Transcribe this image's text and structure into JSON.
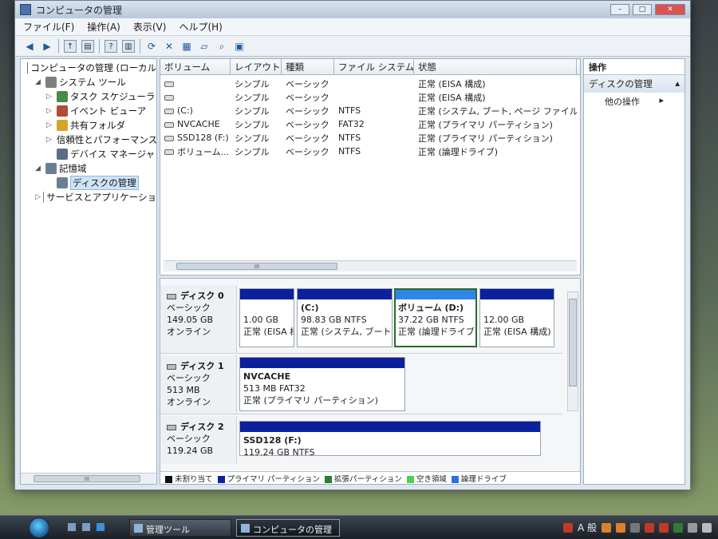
{
  "window": {
    "title": "コンピュータの管理",
    "controls": [
      "–",
      "□",
      "✕"
    ]
  },
  "menu": [
    "ファイル(F)",
    "操作(A)",
    "表示(V)",
    "ヘルプ(H)"
  ],
  "tree": [
    {
      "label": "コンピュータの管理 (ローカル",
      "indent": 0,
      "exp": "",
      "icon": "computer-icon",
      "color": "#4a72a8"
    },
    {
      "label": "システム ツール",
      "indent": 1,
      "exp": "◢",
      "icon": "tools-icon",
      "color": "#7f7f7f"
    },
    {
      "label": "タスク スケジューラ",
      "indent": 2,
      "exp": "▷",
      "icon": "clock-icon",
      "color": "#4a8a4a"
    },
    {
      "label": "イベント ビューア",
      "indent": 2,
      "exp": "▷",
      "icon": "event-icon",
      "color": "#b04b3a"
    },
    {
      "label": "共有フォルダ",
      "indent": 2,
      "exp": "▷",
      "icon": "folder-icon",
      "color": "#d4a52a"
    },
    {
      "label": "信頼性とパフォーマンス",
      "indent": 2,
      "exp": "▷",
      "icon": "performance-icon",
      "color": "#c0392b"
    },
    {
      "label": "デバイス マネージャ",
      "indent": 2,
      "exp": "",
      "icon": "device-icon",
      "color": "#5a6f86"
    },
    {
      "label": "記憶域",
      "indent": 1,
      "exp": "◢",
      "icon": "storage-icon",
      "color": "#6b7f94"
    },
    {
      "label": "ディスクの管理",
      "indent": 2,
      "exp": "",
      "icon": "disk-icon",
      "color": "#6b7f94",
      "selected": true
    },
    {
      "label": "サービスとアプリケーショ",
      "indent": 1,
      "exp": "▷",
      "icon": "services-icon",
      "color": "#6f7f8f"
    }
  ],
  "volumes": {
    "headers": [
      "ボリューム",
      "レイアウト",
      "種類",
      "ファイル システム",
      "状態"
    ],
    "rows": [
      [
        "",
        "シンプル",
        "ベーシック",
        "",
        "正常 (EISA 構成)"
      ],
      [
        "",
        "シンプル",
        "ベーシック",
        "",
        "正常 (EISA 構成)"
      ],
      [
        "(C:)",
        "シンプル",
        "ベーシック",
        "NTFS",
        "正常 (システム, ブート, ページ ファイル, ア"
      ],
      [
        "NVCACHE",
        "シンプル",
        "ベーシック",
        "FAT32",
        "正常 (プライマリ パーティション)"
      ],
      [
        "SSD128 (F:)",
        "シンプル",
        "ベーシック",
        "NTFS",
        "正常 (プライマリ パーティション)"
      ],
      [
        "ボリューム...",
        "シンプル",
        "ベーシック",
        "NTFS",
        "正常 (論理ドライブ)"
      ]
    ]
  },
  "disks": [
    {
      "name": "ディスク 0",
      "type": "ベーシック",
      "size": "149.05 GB",
      "status": "オンライン"
    },
    {
      "name": "ディスク 1",
      "type": "ベーシック",
      "size": "513 MB",
      "status": "オンライン"
    },
    {
      "name": "ディスク 2",
      "type": "ベーシック",
      "size": "119.24 GB",
      "status": ""
    }
  ],
  "partitions": {
    "d0p1": {
      "name": "",
      "size": "1.00 GB",
      "status": "正常 (EISA 構"
    },
    "d0p2": {
      "name": "(C:)",
      "size": "98.83 GB NTFS",
      "status": "正常 (システム, ブート"
    },
    "d0p3": {
      "name": "ボリューム (D:)",
      "size": "37.22 GB NTFS",
      "status": "正常 (論理ドライブ"
    },
    "d0p4": {
      "name": "",
      "size": "12.00 GB",
      "status": "正常 (EISA 構成)"
    },
    "d1p1": {
      "name": "NVCACHE",
      "size": "513 MB FAT32",
      "status": "正常 (プライマリ パーティション)"
    },
    "d2p1": {
      "name": "SSD128  (F:)",
      "size": "119.24 GB NTFS",
      "status": ""
    }
  },
  "legend": [
    {
      "label": "未割り当て",
      "color": "#111111"
    },
    {
      "label": "プライマリ パーティション",
      "color": "#0c1f9c"
    },
    {
      "label": "拡張パーティション",
      "color": "#2e7d32"
    },
    {
      "label": "空き領域",
      "color": "#4cd14c"
    },
    {
      "label": "論理ドライブ",
      "color": "#2f6fe0"
    }
  ],
  "actions": {
    "header": "操作",
    "section": "ディスクの管理",
    "item": "他の操作"
  },
  "taskbar": {
    "btn1": "管理ツール",
    "btn2": "コンピュータの管理",
    "ime": "A 般"
  }
}
